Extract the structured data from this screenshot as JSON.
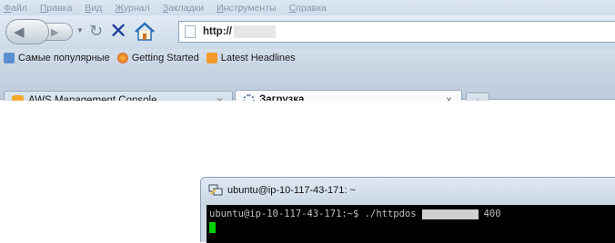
{
  "menu": {
    "items": [
      "Файл",
      "Правка",
      "Вид",
      "Журнал",
      "Закладки",
      "Инструменты",
      "Справка"
    ]
  },
  "nav": {
    "url": "http://",
    "url_redacted": true
  },
  "bookmarks": {
    "items": [
      {
        "label": "Самые популярные",
        "icon": "star-icon"
      },
      {
        "label": "Getting Started",
        "icon": "firefox-icon"
      },
      {
        "label": "Latest Headlines",
        "icon": "rss-icon"
      }
    ]
  },
  "tabs": [
    {
      "label": "AWS Management Console",
      "close": "×",
      "active": false
    },
    {
      "label": "Загрузка...",
      "close": "×",
      "active": true
    }
  ],
  "newtab_label": "+",
  "terminal": {
    "window_title": "ubuntu@ip-10-117-43-171: ~",
    "prompt": "ubuntu@ip-10-117-43-171:~$ ./httpdos",
    "arg_redacted": true,
    "trailing": "400"
  },
  "colors": {
    "chrome_blue": "#cfdceb",
    "terminal_bg": "#000000",
    "cursor_green": "#00d000"
  }
}
